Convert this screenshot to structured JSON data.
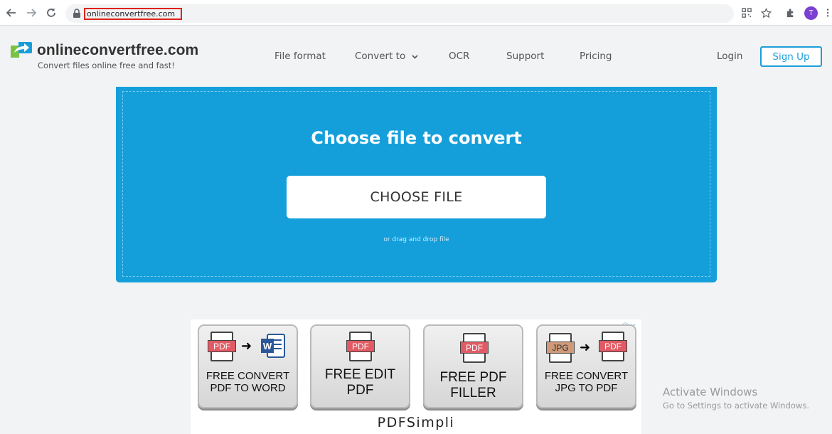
{
  "browser": {
    "url": "onlineconvertfree.com",
    "avatar_letter": "T"
  },
  "site": {
    "logo_name": "onlineconvertfree.com",
    "tagline": "Convert files online free and fast!",
    "nav": {
      "file_format": "File format",
      "convert_to": "Convert to",
      "ocr": "OCR",
      "support": "Support",
      "pricing": "Pricing",
      "login": "Login",
      "signup": "Sign Up"
    },
    "accent": "#1a9ed9"
  },
  "upload": {
    "title": "Choose file to convert",
    "button": "CHOOSE FILE",
    "hint": "or drag and drop file",
    "bg_color": "#149fdb"
  },
  "ad": {
    "cards": [
      {
        "line1": "FREE CONVERT",
        "line2": "PDF TO WORD",
        "from": "PDF"
      },
      {
        "line1": "FREE EDIT",
        "line2": "PDF",
        "from": "PDF"
      },
      {
        "line1": "FREE PDF",
        "line2": "FILLER",
        "from": "PDF"
      },
      {
        "line1": "FREE CONVERT",
        "line2": "JPG TO PDF",
        "from": "JPG",
        "to": "PDF"
      }
    ],
    "brand": "PDFSimpli"
  },
  "watermark": {
    "line1": "Activate Windows",
    "line2": "Go to Settings to activate Windows."
  }
}
